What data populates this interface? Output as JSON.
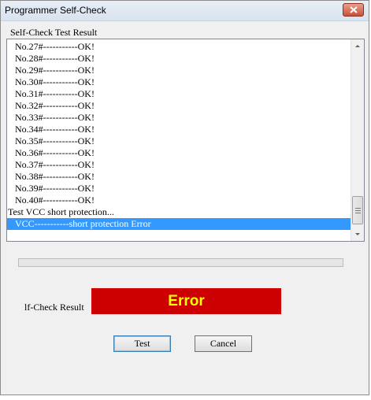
{
  "window": {
    "title": "Programmer Self-Check"
  },
  "group": {
    "label": "Self-Check Test Result"
  },
  "list": {
    "items": [
      "No.27#-----------OK!",
      "No.28#-----------OK!",
      "No.29#-----------OK!",
      "No.30#-----------OK!",
      "No.31#-----------OK!",
      "No.32#-----------OK!",
      "No.33#-----------OK!",
      "No.34#-----------OK!",
      "No.35#-----------OK!",
      "No.36#-----------OK!",
      "No.37#-----------OK!",
      "No.38#-----------OK!",
      "No.39#-----------OK!",
      "No.40#-----------OK!",
      "Test VCC short protection...",
      "VCC-----------short protection Error"
    ],
    "selected_index": 15
  },
  "result": {
    "label": "lf-Check Result",
    "value": "Error",
    "box_color": "#cc0000",
    "text_color": "#ffff00"
  },
  "progress": {
    "fraction": 0
  },
  "buttons": {
    "test_label": "Test",
    "cancel_label": "Cancel"
  },
  "icons": {
    "close": "close-icon",
    "scroll_up": "scroll-up-arrow-icon",
    "scroll_down": "scroll-down-arrow-icon"
  }
}
